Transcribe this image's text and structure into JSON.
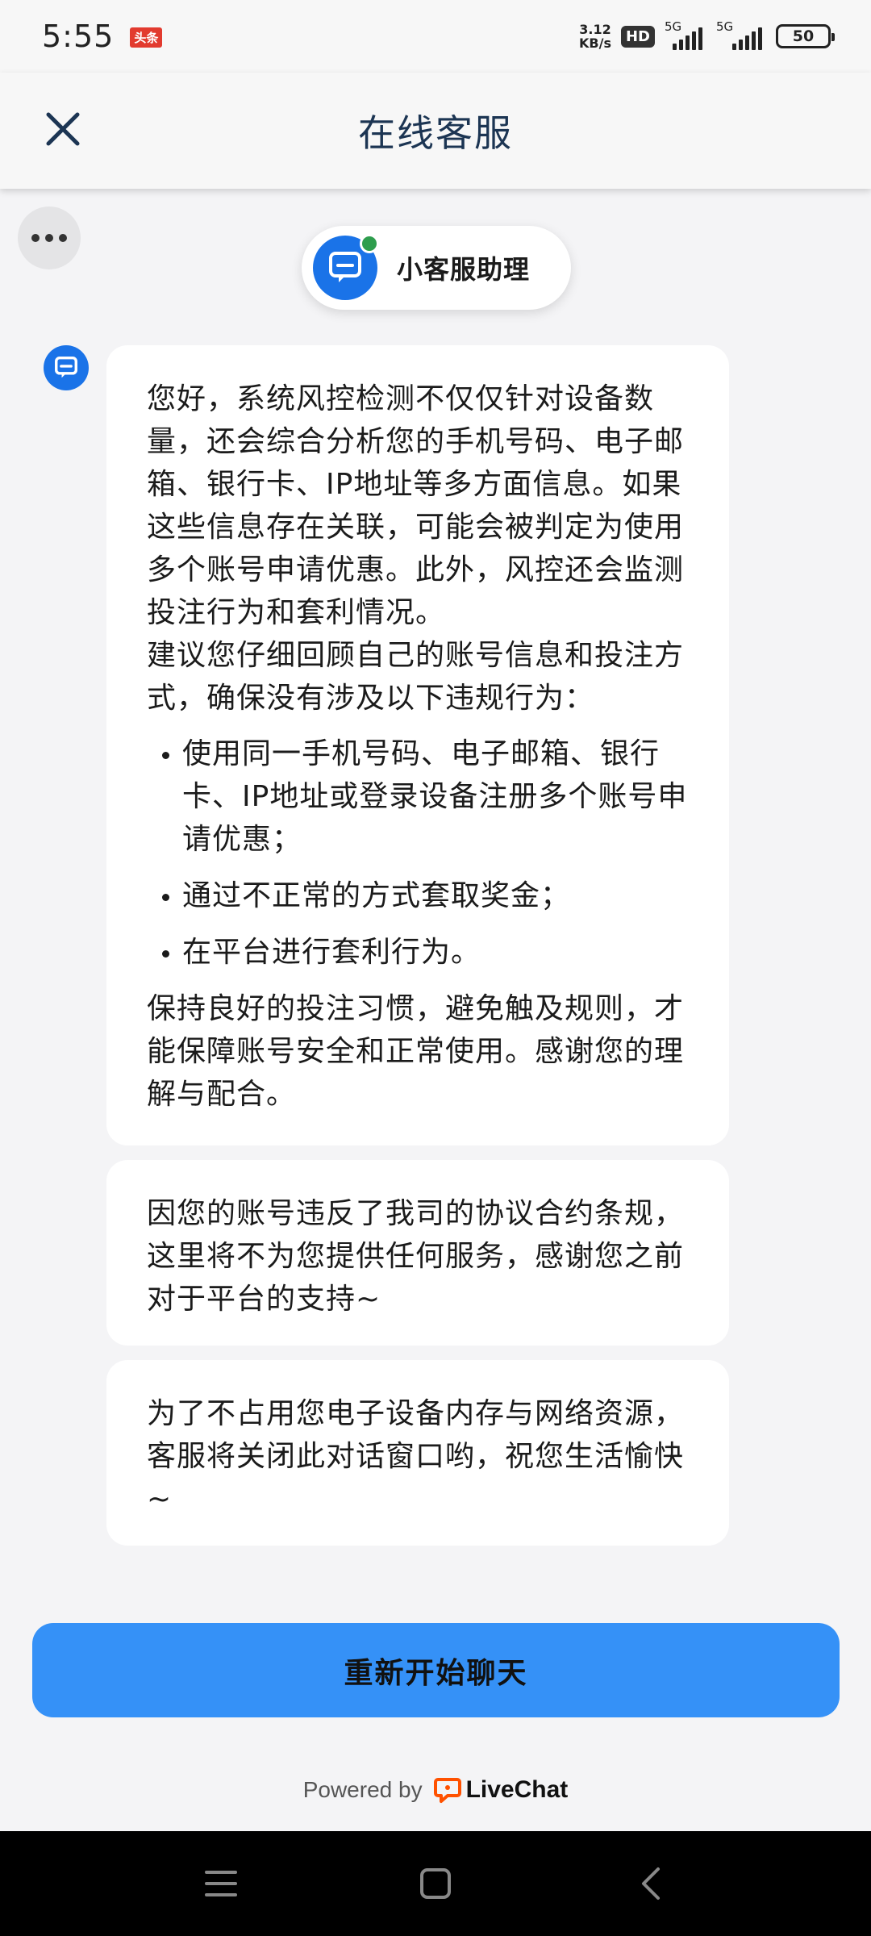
{
  "status_bar": {
    "time": "5:55",
    "notification_badge": "头条",
    "net_speed_value": "3.12",
    "net_speed_unit": "KB/s",
    "hd_label": "HD",
    "signal1_label": "5G",
    "signal2_label": "5G",
    "battery": "50"
  },
  "header": {
    "title": "在线客服"
  },
  "agent": {
    "name": "小客服助理"
  },
  "messages": {
    "m1": {
      "intro": "您好，系统风控检测不仅仅针对设备数量，还会综合分析您的手机号码、电子邮箱、银行卡、IP地址等多方面信息。如果这些信息存在关联，可能会被判定为使用多个账号申请优惠。此外，风控还会监测投注行为和套利情况。",
      "advice": "建议您仔细回顾自己的账号信息和投注方式，确保没有涉及以下违规行为：",
      "items": [
        "使用同一手机号码、电子邮箱、银行卡、IP地址或登录设备注册多个账号申请优惠；",
        "通过不正常的方式套取奖金；",
        "在平台进行套利行为。"
      ],
      "outro": "保持良好的投注习惯，避免触及规则，才能保障账号安全和正常使用。感谢您的理解与配合。"
    },
    "m2": "因您的账号违反了我司的协议合约条规，这里将不为您提供任何服务，感谢您之前对于平台的支持~",
    "m3": "为了不占用您电子设备内存与网络资源，客服将关闭此对话窗口哟，祝您生活愉快~"
  },
  "restart_button": "重新开始聊天",
  "footer": {
    "powered_by": "Powered by",
    "brand": "LiveChat"
  },
  "colors": {
    "accent": "#3591f7",
    "avatar": "#1a73e8",
    "online": "#2e9d4d",
    "brand_logo": "#ff5100"
  }
}
